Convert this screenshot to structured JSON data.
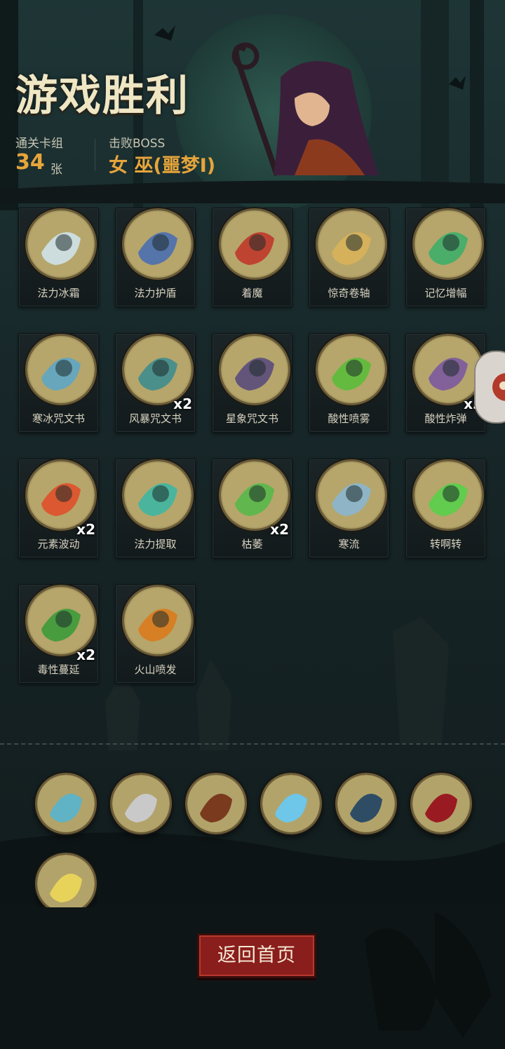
{
  "header": {
    "title": "游戏胜利",
    "deck_label": "通关卡组",
    "deck_count": "34",
    "deck_unit": "张",
    "boss_label": "击败BOSS",
    "boss_name": "女 巫(噩梦I)"
  },
  "cards": [
    {
      "name": "法力冰霜",
      "multiplier": "",
      "icon": "frost-mana-icon",
      "color": "#cfe3ea"
    },
    {
      "name": "法力护盾",
      "multiplier": "",
      "icon": "mana-shield-icon",
      "color": "#4a6fb0"
    },
    {
      "name": "着魔",
      "multiplier": "",
      "icon": "possessed-icon",
      "color": "#c0392b"
    },
    {
      "name": "惊奇卷轴",
      "multiplier": "",
      "icon": "scroll-icon",
      "color": "#d9b25a"
    },
    {
      "name": "记忆增幅",
      "multiplier": "",
      "icon": "brain-icon",
      "color": "#3fae6a"
    },
    {
      "name": "寒冰咒文书",
      "multiplier": "",
      "icon": "ice-spellbook-icon",
      "color": "#5fa6c4"
    },
    {
      "name": "风暴咒文书",
      "multiplier": "x2",
      "icon": "storm-spellbook-icon",
      "color": "#3f8d8f"
    },
    {
      "name": "星象咒文书",
      "multiplier": "",
      "icon": "star-spellbook-icon",
      "color": "#5a4c7c"
    },
    {
      "name": "酸性喷雾",
      "multiplier": "",
      "icon": "acid-spray-icon",
      "color": "#5bbd3a"
    },
    {
      "name": "酸性炸弹",
      "multiplier": "x3",
      "icon": "acid-bomb-icon",
      "color": "#7c5aa0"
    },
    {
      "name": "元素波动",
      "multiplier": "x2",
      "icon": "elemental-wave-icon",
      "color": "#e0502a"
    },
    {
      "name": "法力提取",
      "multiplier": "",
      "icon": "mana-skull-icon",
      "color": "#3fb6a2"
    },
    {
      "name": "枯萎",
      "multiplier": "x2",
      "icon": "wither-icon",
      "color": "#58b84a"
    },
    {
      "name": "寒流",
      "multiplier": "",
      "icon": "cold-current-icon",
      "color": "#8ab6cf"
    },
    {
      "name": "转啊转",
      "multiplier": "",
      "icon": "green-vortex-icon",
      "color": "#58d04a"
    },
    {
      "name": "毒性蔓延",
      "multiplier": "x2",
      "icon": "poison-spread-icon",
      "color": "#3c9b3a"
    },
    {
      "name": "火山喷发",
      "multiplier": "",
      "icon": "volcano-icon",
      "color": "#d97b1d"
    }
  ],
  "relics": [
    {
      "icon": "open-book-relic-icon",
      "color": "#5fb3c4"
    },
    {
      "icon": "magnifier-relic-icon",
      "color": "#c9c9c9"
    },
    {
      "icon": "holy-tome-relic-icon",
      "color": "#7a3a1e"
    },
    {
      "icon": "ice-crystal-relic-icon",
      "color": "#6ec6e8"
    },
    {
      "icon": "tornado-relic-icon",
      "color": "#2e4c64"
    },
    {
      "icon": "vampire-relic-icon",
      "color": "#9a1a22"
    },
    {
      "icon": "glowing-book-relic-icon",
      "color": "#e7d35a"
    }
  ],
  "footer": {
    "return_label": "返回首页"
  },
  "colors": {
    "accent": "#e7a53b",
    "button": "#8a1e1c",
    "frame": "#6b5b37"
  }
}
